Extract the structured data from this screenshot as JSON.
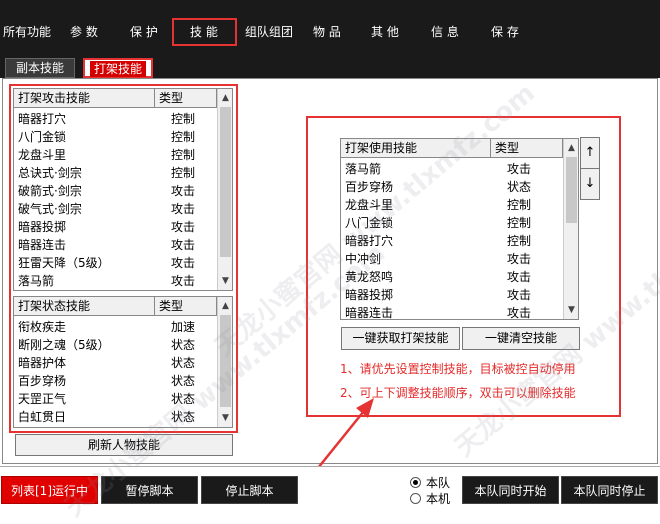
{
  "menu": {
    "items": [
      "所有功能",
      "参  数",
      "保  护",
      "技  能",
      "组队组团",
      "物  品",
      "其  他",
      "信  息",
      "保  存"
    ],
    "active_index": 3
  },
  "tabs": {
    "items": [
      "副本技能",
      "打架技能"
    ],
    "active_index": 1
  },
  "attack_list": {
    "col_name": "打架攻击技能",
    "col_type": "类型",
    "rows": [
      {
        "name": "暗器打穴",
        "type": "控制"
      },
      {
        "name": "八门金锁",
        "type": "控制"
      },
      {
        "name": "龙盘斗里",
        "type": "控制"
      },
      {
        "name": "总诀式·剑宗",
        "type": "控制"
      },
      {
        "name": "破箭式·剑宗",
        "type": "攻击"
      },
      {
        "name": "破气式·剑宗",
        "type": "攻击"
      },
      {
        "name": "暗器投掷",
        "type": "攻击"
      },
      {
        "name": "暗器连击",
        "type": "攻击"
      },
      {
        "name": "狂雷天降（5级）",
        "type": "攻击"
      },
      {
        "name": "落马箭",
        "type": "攻击"
      }
    ]
  },
  "status_list": {
    "col_name": "打架状态技能",
    "col_type": "类型",
    "rows": [
      {
        "name": "衔枚疾走",
        "type": "加速"
      },
      {
        "name": "断刚之魂（5级）",
        "type": "状态"
      },
      {
        "name": "暗器护体",
        "type": "状态"
      },
      {
        "name": "百步穿杨",
        "type": "状态"
      },
      {
        "name": "天罡正气",
        "type": "状态"
      },
      {
        "name": "白虹贯日",
        "type": "状态"
      }
    ]
  },
  "refresh_button": "刷新人物技能",
  "use_list": {
    "col_name": "打架使用技能",
    "col_type": "类型",
    "rows": [
      {
        "name": "落马箭",
        "type": "攻击"
      },
      {
        "name": "百步穿杨",
        "type": "状态"
      },
      {
        "name": "龙盘斗里",
        "type": "控制"
      },
      {
        "name": "八门金锁",
        "type": "控制"
      },
      {
        "name": "暗器打穴",
        "type": "控制"
      },
      {
        "name": "中冲剑",
        "type": "攻击"
      },
      {
        "name": "黄龙怒鸣",
        "type": "攻击"
      },
      {
        "name": "暗器投掷",
        "type": "攻击"
      },
      {
        "name": "暗器连击",
        "type": "攻击"
      }
    ]
  },
  "up_button": "↑",
  "down_button": "↓",
  "fetch_button": "一键获取打架技能",
  "clear_button": "一键清空技能",
  "notes": [
    "1、请优先设置控制技能，目标被控自动停用",
    "2、可上下调整技能顺序，双击可以删除技能"
  ],
  "bottom": {
    "run_list": "列表[1]运行中",
    "pause": "暂停脚本",
    "stop": "停止脚本",
    "radio_team": "本队",
    "radio_machine": "本机",
    "selected_radio": "本队",
    "start_all": "本队同时开始",
    "stop_all": "本队同时停止"
  },
  "watermark": "天龙小蜜官网 www.tlxmfz.com",
  "colors": {
    "highlight_red": "#e53333",
    "dark_bar": "#1a1a1a",
    "note_red": "#e52a2a"
  }
}
